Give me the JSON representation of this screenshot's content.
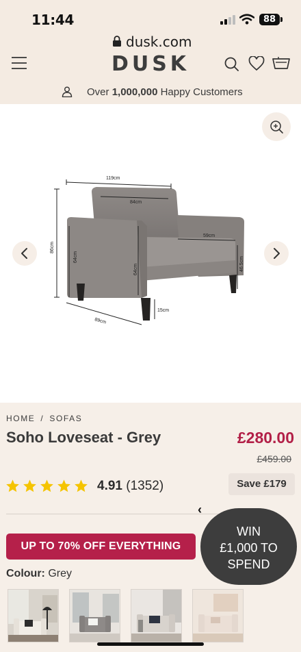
{
  "status": {
    "time": "11:44",
    "battery": "88"
  },
  "browser": {
    "url": "dusk.com"
  },
  "header": {
    "logo": "DUSK"
  },
  "banner": {
    "prefix": "Over ",
    "highlight": "1,000,000",
    "suffix": " Happy Customers"
  },
  "dimensions": {
    "width": "119cm",
    "back_width": "84cm",
    "seat_depth": "59cm",
    "height": "86cm",
    "arm_height_left": "64cm",
    "arm_height_front": "64cm",
    "seat_height": "46.5cm",
    "depth": "89cm",
    "leg_height": "15cm"
  },
  "breadcrumb": {
    "home": "HOME",
    "separator": "/",
    "category": "SOFAS"
  },
  "product": {
    "title": "Soho Loveseat - Grey",
    "price": "£280.00",
    "was_price": "£459.00",
    "rating": "4.91",
    "review_count": "(1352)",
    "stars": 5,
    "save_label": "Save £179",
    "colour_label": "Colour:",
    "colour_value": " Grey"
  },
  "promo": {
    "label": "UP TO 70% OFF EVERYTHING"
  },
  "win": {
    "line1": "WIN",
    "line2": "£1,000 TO",
    "line3": "SPEND"
  },
  "colors": {
    "accent": "#b5204a",
    "price": "#b21f47",
    "background": "#f6efe8",
    "star": "#f5c400"
  },
  "icons": [
    "menu-icon",
    "search-icon",
    "heart-icon",
    "basket-icon",
    "person-icon",
    "zoom-in-icon",
    "chevron-left-icon",
    "chevron-right-icon",
    "lock-icon"
  ]
}
